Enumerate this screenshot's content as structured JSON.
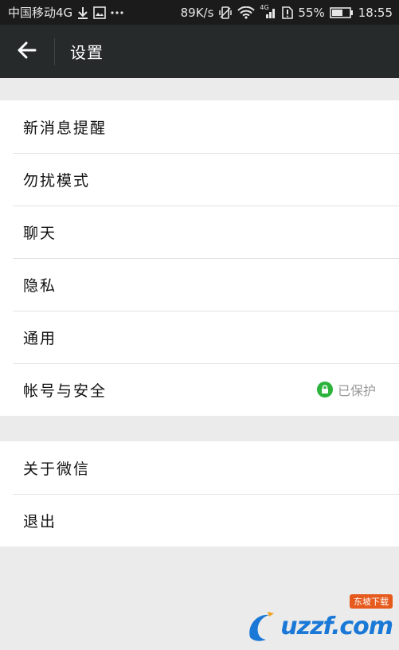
{
  "status_bar": {
    "carrier": "中国移动4G",
    "speed": "89K/s",
    "network": "4G",
    "battery_percent": "55%",
    "time": "18:55"
  },
  "app_bar": {
    "title": "设置"
  },
  "sections": [
    {
      "items": [
        {
          "label": "新消息提醒"
        },
        {
          "label": "勿扰模式"
        },
        {
          "label": "聊天"
        },
        {
          "label": "隐私"
        },
        {
          "label": "通用"
        },
        {
          "label": "帐号与安全",
          "status": "已保护"
        }
      ]
    },
    {
      "items": [
        {
          "label": "关于微信"
        },
        {
          "label": "退出"
        }
      ]
    }
  ],
  "watermark": {
    "brand": "uzzf.com",
    "badge": "东坡下载"
  },
  "colors": {
    "status_bar_bg": "#1b1b1b",
    "app_bar_bg": "#262a2b",
    "page_bg": "#ebebeb",
    "protect_green": "#2bb33c"
  }
}
